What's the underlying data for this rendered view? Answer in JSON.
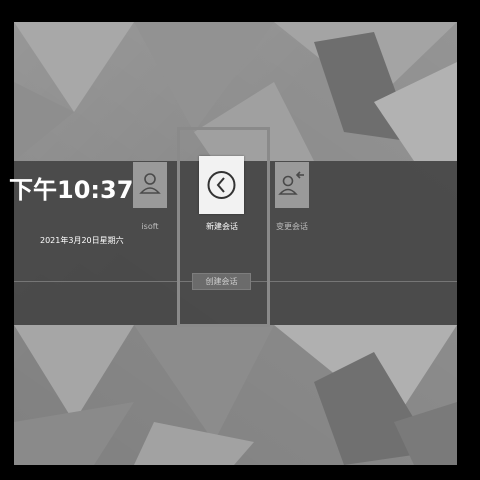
{
  "lock_screen": {
    "time": "下午10:37",
    "date": "2021年3月20日星期六"
  },
  "sessions": [
    {
      "label": "isoft",
      "icon": "user-icon"
    },
    {
      "label": "新建会话",
      "icon": "back-arrow-icon"
    },
    {
      "label": "变更会话",
      "icon": "switch-user-icon"
    }
  ],
  "actions": {
    "create_session_label": "创建会话"
  },
  "colors": {
    "band": "#424242",
    "tile": "#9a9a9a",
    "tile_selected": "#f2f2f2",
    "text": "#ffffff"
  }
}
